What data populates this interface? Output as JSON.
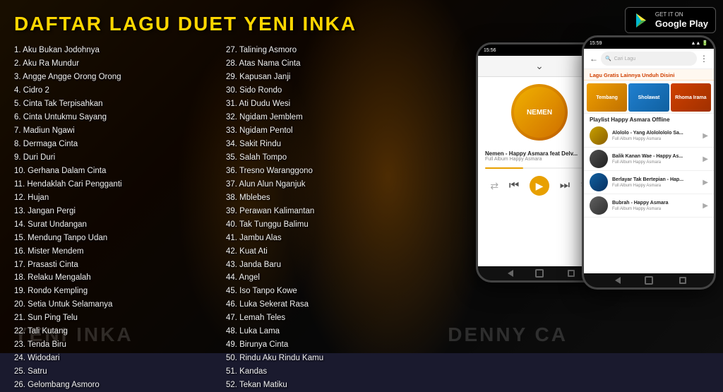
{
  "app": {
    "title": "DAFTAR LAGU DUET YENI INKA",
    "google_play": {
      "get_it_on": "GET IT ON",
      "store_name": "Google Play"
    }
  },
  "songs_col1": [
    "1.  Aku Bukan Jodohnya",
    "2.  Aku Ra Mundur",
    "3.  Angge Angge Orong Orong",
    "4.  Cidro 2",
    "5.  Cinta Tak Terpisahkan",
    "6.  Cinta Untukmu Sayang",
    "7.  Madiun Ngawi",
    "8.  Dermaga Cinta",
    "9.  Duri Duri",
    "10. Gerhana Dalam Cinta",
    "11. Hendaklah Cari Pengganti",
    "12. Hujan",
    "13. Jangan Pergi",
    "14. Surat Undangan",
    "15. Mendung Tanpo Udan",
    "16. Mister Mendem",
    "17. Prasasti Cinta",
    "18. Relaku Mengalah",
    "19. Rondo Kempling",
    "20. Setia Untuk Selamanya",
    "21. Sun Ping Telu",
    "22. Tali Kutang",
    "23. Tenda Biru",
    "24. Widodari",
    "25. Satru",
    "26. Gelombang Asmoro"
  ],
  "songs_col2": [
    "27. Talining Asmoro",
    "28. Atas Nama Cinta",
    "29. Kapusan Janji",
    "30. Sido Rondo",
    "31. Ati Dudu Wesi",
    "32. Ngidam Jemblem",
    "33. Ngidam Pentol",
    "34. Sakit Rindu",
    "35. Salah Tompo",
    "36. Tresno Waranggono",
    "37. Alun Alun Nganjuk",
    "38. Mblebes",
    "39. Perawan Kalimantan",
    "40. Tak Tunggu Balimu",
    "41. Jambu Alas",
    "42. Kuat Ati",
    "43. Janda Baru",
    "44. Angel",
    "45. Iso Tanpo Kowe",
    "46. Luka Sekerat Rasa",
    "47. Lemah Teles",
    "48. Luka Lama",
    "49. Birunya Cinta",
    "50. Rindu Aku Rindu Kamu",
    "51. Kandas",
    "52. Tekan Matiku"
  ],
  "phone_back": {
    "time": "15:56",
    "song_title": "Nemen - Happy Asmara feat Delv...",
    "album": "Full Album Happy Asmara",
    "album_art_text": "NEMEN"
  },
  "phone_front": {
    "time": "15:59",
    "battery": "88+",
    "search_placeholder": "Cari Lagu",
    "banner_title": "Lagu Gratis Lainnya Unduh Disini",
    "ads": [
      "Tembang",
      "Sholawat",
      "Rhoma Irama"
    ],
    "playlist_title": "Playlist Happy Asmara Offline",
    "songs": [
      {
        "name": "Alololo - Yang Alololololo Sa...",
        "artist": "Full Album Happy Asmara"
      },
      {
        "name": "Balik Kanan Wae - Happy As...",
        "artist": "Full Album Happy Asmara"
      },
      {
        "name": "Berlayar Tak Bertepian - Hap...",
        "artist": "Full Album Happy Asmara"
      },
      {
        "name": "Bubrah - Happy Asmara",
        "artist": "Full Album Happy Asmara"
      }
    ]
  },
  "watermarks": {
    "left": "YENI INKA",
    "right": "DENNY CA..."
  }
}
